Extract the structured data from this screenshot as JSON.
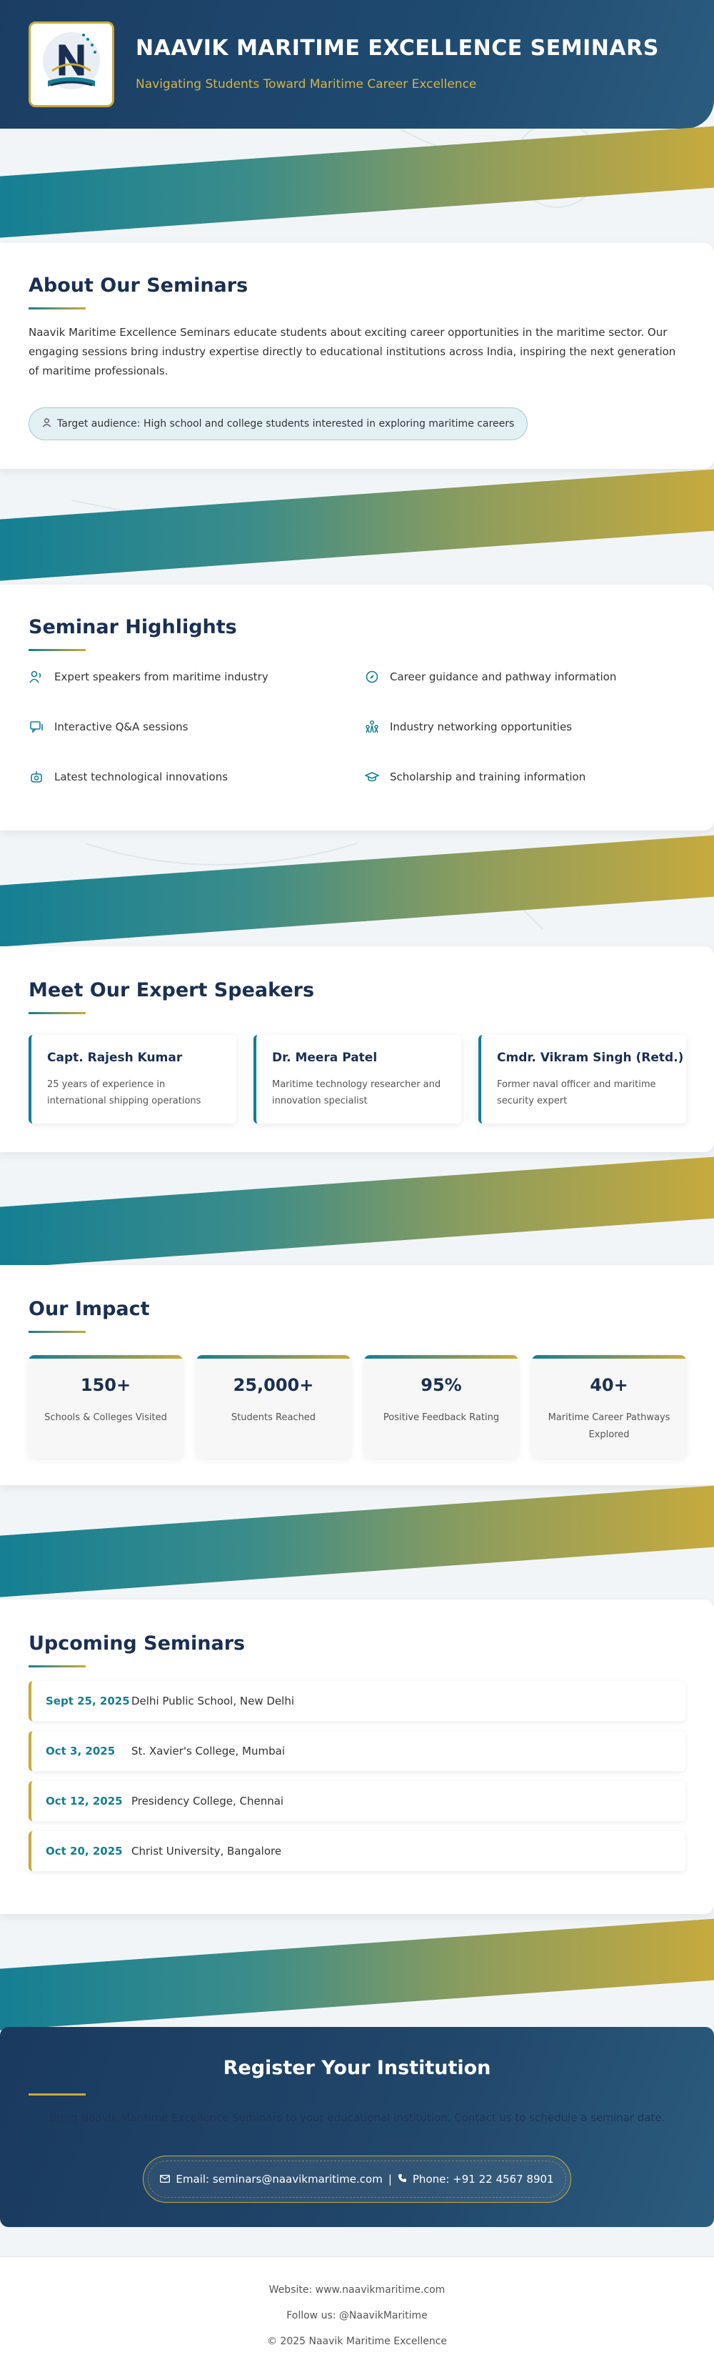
{
  "header": {
    "title": "NAAVIK MARITIME EXCELLENCE SEMINARS",
    "subtitle": "Navigating Students Toward Maritime Career Excellence",
    "logo_icon": "ship-and-book-logo"
  },
  "about": {
    "title": "About Our Seminars",
    "description": "Naavik Maritime Excellence Seminars educate students about exciting career opportunities in the maritime sector. Our engaging sessions bring industry expertise directly to educational institutions across India, inspiring the next generation of maritime professionals.",
    "audience": "Target audience: High school and college students interested in exploring maritime careers",
    "audience_icon": "person-icon"
  },
  "highlights": {
    "title": "Seminar Highlights",
    "items": [
      {
        "label": "Expert speakers from maritime industry",
        "icon": "speaker-icon"
      },
      {
        "label": "Career guidance and pathway information",
        "icon": "compass-icon"
      },
      {
        "label": "Interactive Q&A sessions",
        "icon": "chat-icon"
      },
      {
        "label": "Industry networking opportunities",
        "icon": "network-icon"
      },
      {
        "label": "Latest technological innovations",
        "icon": "robot-icon"
      },
      {
        "label": "Scholarship and training information",
        "icon": "graduation-cap-icon"
      }
    ]
  },
  "speakers": {
    "title": "Meet Our Expert Speakers",
    "items": [
      {
        "name": "Capt. Rajesh Kumar",
        "desc": "25 years of experience in international shipping operations"
      },
      {
        "name": "Dr. Meera Patel",
        "desc": "Maritime technology researcher and innovation specialist"
      },
      {
        "name": "Cmdr. Vikram Singh (Retd.)",
        "desc": "Former naval officer and maritime security expert"
      }
    ]
  },
  "impact": {
    "title": "Our Impact",
    "items": [
      {
        "value": "150+",
        "label": "Schools & Colleges Visited"
      },
      {
        "value": "25,000+",
        "label": "Students Reached"
      },
      {
        "value": "95%",
        "label": "Positive Feedback Rating"
      },
      {
        "value": "40+",
        "label": "Maritime Career Pathways Explored"
      }
    ]
  },
  "upcoming": {
    "title": "Upcoming Seminars",
    "items": [
      {
        "date": "Sept 25, 2025",
        "place": "Delhi Public School, New Delhi"
      },
      {
        "date": "Oct 3, 2025",
        "place": "St. Xavier's College, Mumbai"
      },
      {
        "date": "Oct 12, 2025",
        "place": "Presidency College, Chennai"
      },
      {
        "date": "Oct 20, 2025",
        "place": "Christ University, Bangalore"
      }
    ]
  },
  "register": {
    "title": "Register Your Institution",
    "text": "Bring Naavik Maritime Excellence Seminars to your educational institution. Contact us to schedule a seminar date.",
    "email_label": "Email: seminars@naavikmaritime.com",
    "separator": "|",
    "phone_label": "Phone: +91 22 4567 8901",
    "email_icon": "envelope-icon",
    "phone_icon": "phone-icon"
  },
  "footer": {
    "website": "Website: www.naavikmaritime.com",
    "follow": "Follow us: @NaavikMaritime",
    "copyright": "© 2025 Naavik Maritime Excellence"
  },
  "colors": {
    "navy": "#1a2f52",
    "teal": "#137e94",
    "gold": "#c9ab3c"
  }
}
